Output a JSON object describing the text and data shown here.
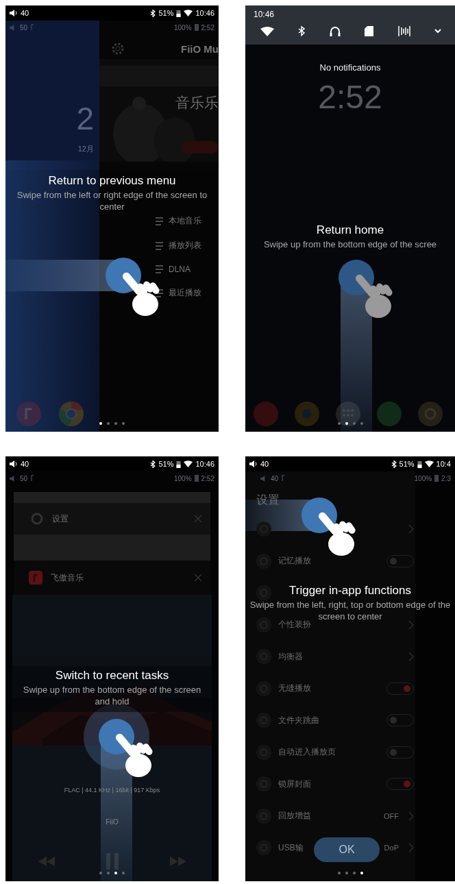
{
  "panels": [
    {
      "kind": "home_screen",
      "status_bar": {
        "volume": "40",
        "battery": "51%",
        "time": "10:46"
      },
      "inner_status": {
        "volume": "50",
        "battery": "100%",
        "time": "2:52"
      },
      "clock": "2",
      "date": "12月",
      "app_title": "FiiO Mu",
      "banner_title": "音乐乐",
      "menu": [
        {
          "label": "本地音乐"
        },
        {
          "label": "播放列表"
        },
        {
          "label": "DLNA"
        },
        {
          "label": "最近播放"
        }
      ],
      "tutorial": {
        "title": "Return to previous menu",
        "hint": "Swipe from the left or right edge of the screen to center",
        "kind": "swipe_right"
      },
      "dots": [
        {
          "selected": true
        },
        {
          "selected": false
        },
        {
          "selected": false
        },
        {
          "selected": false
        }
      ]
    },
    {
      "kind": "notification_shade",
      "shade": {
        "time": "10:46"
      },
      "message": "No notifications",
      "clock": "2:52",
      "tutorial": {
        "title": "Return home",
        "hint": "Swipe up from the bottom edge of the scree",
        "kind": "swipe_up"
      },
      "dots": [
        {
          "selected": false
        },
        {
          "selected": true
        },
        {
          "selected": false
        },
        {
          "selected": false
        }
      ]
    },
    {
      "kind": "recent_tasks",
      "status_bar": {
        "volume": "40",
        "battery": "51%",
        "time": "10:46"
      },
      "inner_status": {
        "volume": "50",
        "battery": "100%",
        "time": "2:52"
      },
      "tasks": [
        {
          "kind": "system",
          "label": "设置"
        },
        {
          "kind": "hidden"
        },
        {
          "kind": "player",
          "label": "飞傲音乐"
        }
      ],
      "player": {
        "info": "FLAC | 44.1 KHz | 16bit | 917 Kbps",
        "artist": "FiiO"
      },
      "tutorial": {
        "title": "Switch to recent tasks",
        "hint": "Swipe up from the bottom edge of the screen and hold",
        "kind": "hold"
      },
      "dots": [
        {
          "selected": false
        },
        {
          "selected": false
        },
        {
          "selected": true
        },
        {
          "selected": false
        }
      ]
    },
    {
      "kind": "settings",
      "status_bar": {
        "volume": "40",
        "battery": "51%",
        "time": "10:4"
      },
      "inner_status": {
        "volume": "40",
        "battery": "100%",
        "time": "2:3"
      },
      "title": "设置",
      "rows": [
        {
          "kind": "link"
        },
        {
          "kind": "toggle",
          "label": "记忆播放",
          "on": false
        },
        {
          "kind": "plain"
        },
        {
          "kind": "link",
          "label": "个性装扮"
        },
        {
          "kind": "link",
          "label": "均衡器"
        },
        {
          "kind": "toggle",
          "label": "无缝播放",
          "on": true
        },
        {
          "kind": "toggle",
          "label": "文件夹跳曲",
          "on": false
        },
        {
          "kind": "toggle",
          "label": "自动进入播放页",
          "on": false
        },
        {
          "kind": "toggle",
          "label": "锁屏封面",
          "on": true
        },
        {
          "kind": "link",
          "label": "回放增益",
          "value": "OFF"
        },
        {
          "kind": "link",
          "label": "USB输",
          "value": "DoP"
        }
      ],
      "button": "OK",
      "tutorial": {
        "title": "Trigger in-app functions",
        "hint": "Swipe from the left, right, top or bottom edge of the screen to center",
        "kind": "swipe_right_top"
      },
      "dots": [
        {
          "selected": false
        },
        {
          "selected": false
        },
        {
          "selected": false
        },
        {
          "selected": true
        }
      ]
    }
  ]
}
